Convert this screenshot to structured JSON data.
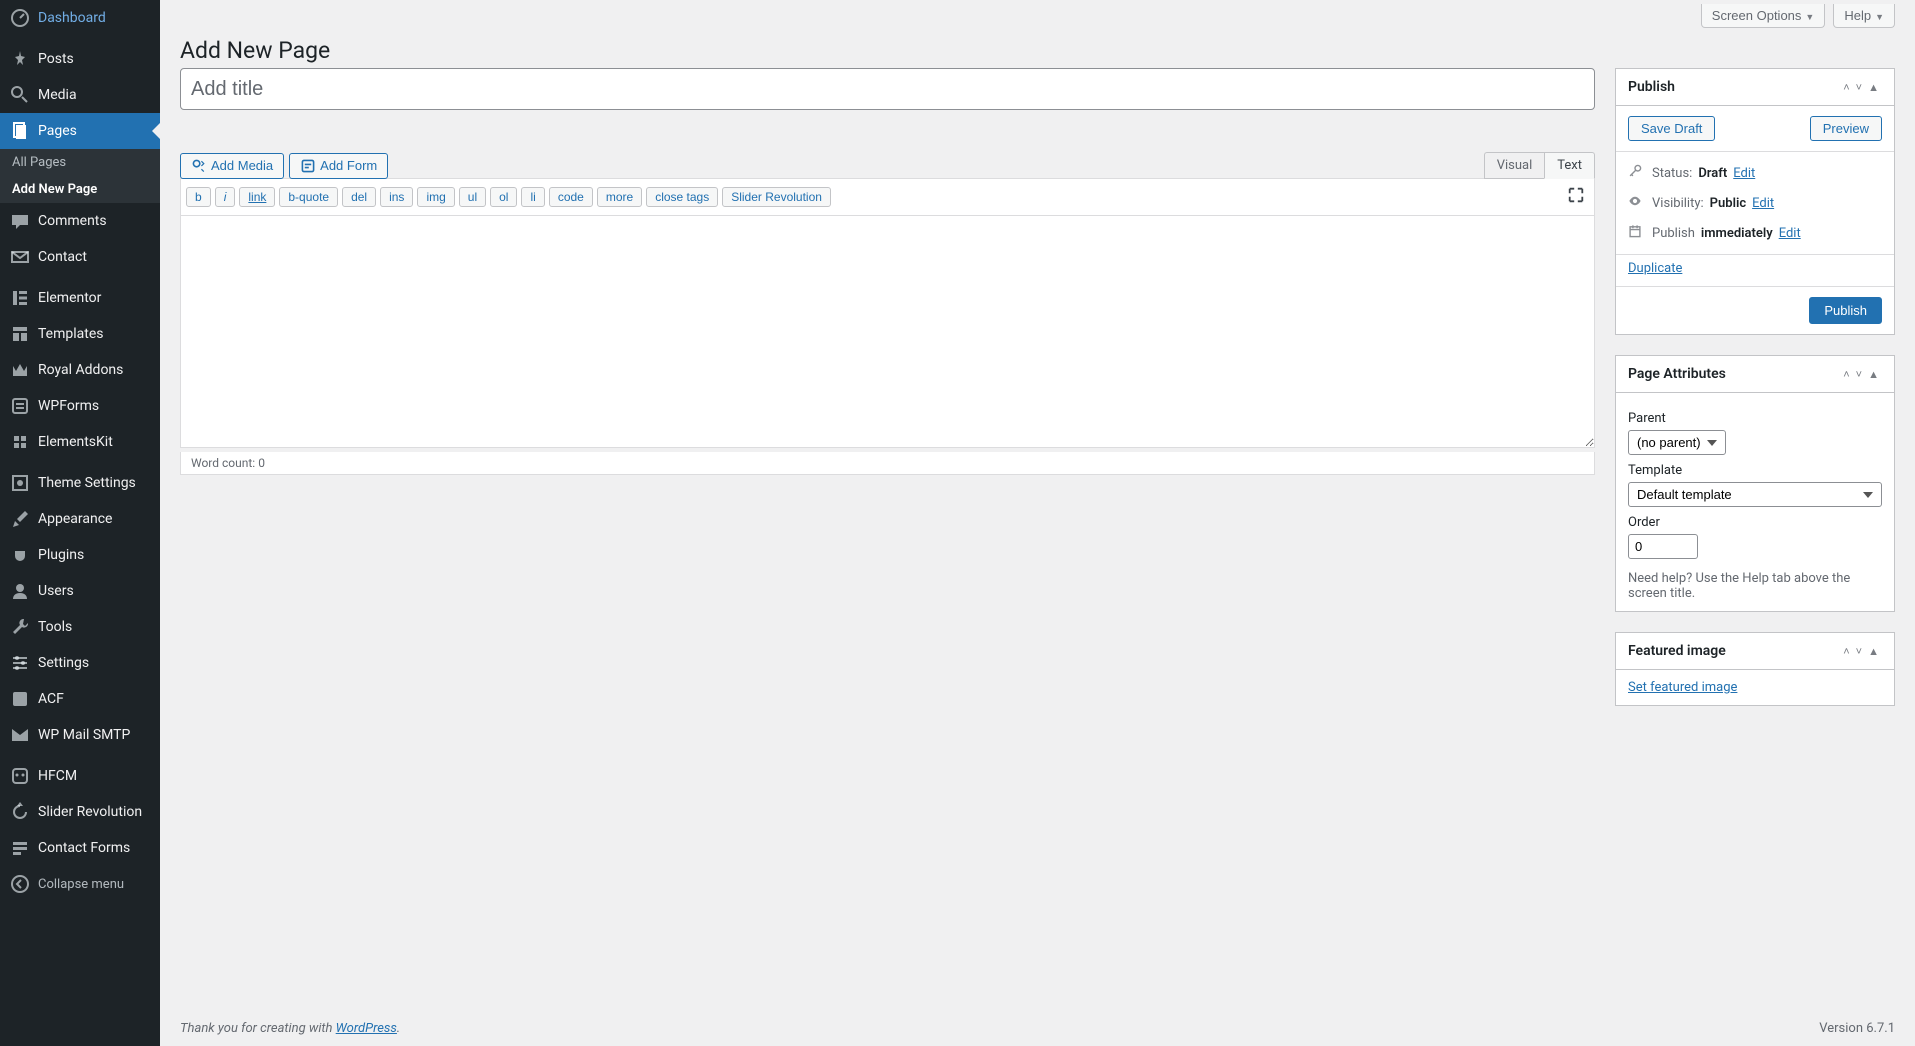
{
  "sidebar": {
    "items": [
      {
        "label": "Dashboard",
        "icon": "dashboard"
      },
      {
        "label": "Posts",
        "icon": "pin"
      },
      {
        "label": "Media",
        "icon": "media"
      },
      {
        "label": "Pages",
        "icon": "pages",
        "active": true
      },
      {
        "label": "Comments",
        "icon": "comment"
      },
      {
        "label": "Contact",
        "icon": "mail"
      },
      {
        "label": "Elementor",
        "icon": "elementor"
      },
      {
        "label": "Templates",
        "icon": "templates"
      },
      {
        "label": "Royal Addons",
        "icon": "royal"
      },
      {
        "label": "WPForms",
        "icon": "wpforms"
      },
      {
        "label": "ElementsKit",
        "icon": "ekit"
      },
      {
        "label": "Theme Settings",
        "icon": "theme"
      },
      {
        "label": "Appearance",
        "icon": "brush"
      },
      {
        "label": "Plugins",
        "icon": "plugin"
      },
      {
        "label": "Users",
        "icon": "user"
      },
      {
        "label": "Tools",
        "icon": "wrench"
      },
      {
        "label": "Settings",
        "icon": "sliders"
      },
      {
        "label": "ACF",
        "icon": "acf"
      },
      {
        "label": "WP Mail SMTP",
        "icon": "smtp"
      },
      {
        "label": "HFCM",
        "icon": "hfcm"
      },
      {
        "label": "Slider Revolution",
        "icon": "revslider"
      },
      {
        "label": "Contact Forms",
        "icon": "cforms"
      }
    ],
    "sub": {
      "all_pages": "All Pages",
      "add_new": "Add New Page"
    },
    "collapse": "Collapse menu"
  },
  "topbar": {
    "screen_options": "Screen Options",
    "help": "Help"
  },
  "page": {
    "title": "Add New Page",
    "title_placeholder": "Add title"
  },
  "editor": {
    "add_media": "Add Media",
    "add_form": "Add Form",
    "tabs": {
      "visual": "Visual",
      "text": "Text"
    },
    "quicktags": [
      "b",
      "i",
      "link",
      "b-quote",
      "del",
      "ins",
      "img",
      "ul",
      "ol",
      "li",
      "code",
      "more",
      "close tags",
      "Slider Revolution"
    ],
    "word_count_label": "Word count: ",
    "word_count": "0"
  },
  "publish": {
    "title": "Publish",
    "save_draft": "Save Draft",
    "preview": "Preview",
    "status_label": "Status:",
    "status_value": "Draft",
    "visibility_label": "Visibility:",
    "visibility_value": "Public",
    "publish_label": "Publish",
    "publish_value": "immediately",
    "edit": "Edit",
    "duplicate": "Duplicate",
    "publish_btn": "Publish"
  },
  "attributes": {
    "title": "Page Attributes",
    "parent_label": "Parent",
    "parent_value": "(no parent)",
    "template_label": "Template",
    "template_value": "Default template",
    "order_label": "Order",
    "order_value": "0",
    "help": "Need help? Use the Help tab above the screen title."
  },
  "featured": {
    "title": "Featured image",
    "set_link": "Set featured image"
  },
  "footer": {
    "thank_pre": "Thank you for creating with ",
    "thank_link": "WordPress",
    "thank_post": ".",
    "version": "Version 6.7.1"
  }
}
